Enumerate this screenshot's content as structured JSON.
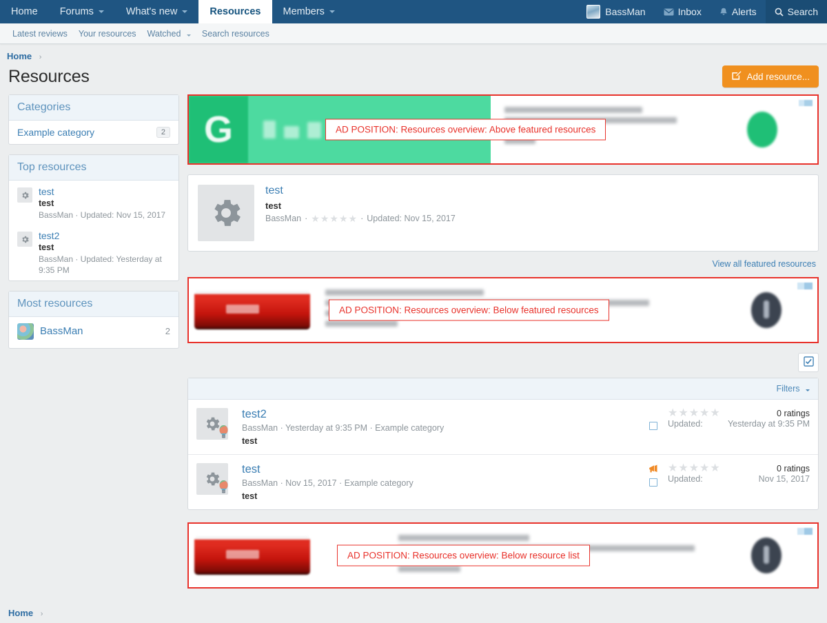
{
  "nav": {
    "items": [
      {
        "label": "Home",
        "has_caret": false,
        "active": false
      },
      {
        "label": "Forums",
        "has_caret": true,
        "active": false
      },
      {
        "label": "What's new",
        "has_caret": true,
        "active": false
      },
      {
        "label": "Resources",
        "has_caret": false,
        "active": true
      },
      {
        "label": "Members",
        "has_caret": true,
        "active": false
      }
    ],
    "right": {
      "username": "BassMan",
      "inbox": "Inbox",
      "alerts": "Alerts",
      "search": "Search"
    }
  },
  "subnav": {
    "items": [
      {
        "label": "Latest reviews",
        "has_caret": false
      },
      {
        "label": "Your resources",
        "has_caret": false
      },
      {
        "label": "Watched",
        "has_caret": true
      },
      {
        "label": "Search resources",
        "has_caret": false
      }
    ]
  },
  "breadcrumb": {
    "home": "Home"
  },
  "page": {
    "title": "Resources",
    "add_button": "Add resource..."
  },
  "sidebar": {
    "categories": {
      "header": "Categories",
      "items": [
        {
          "label": "Example category",
          "count": "2"
        }
      ]
    },
    "top_resources": {
      "header": "Top resources",
      "items": [
        {
          "title": "test",
          "desc": "test",
          "meta": "BassMan · Updated: Nov 15, 2017"
        },
        {
          "title": "test2",
          "desc": "test",
          "meta": "BassMan · Updated: Yesterday at 9:35 PM"
        }
      ]
    },
    "most_resources": {
      "header": "Most resources",
      "items": [
        {
          "name": "BassMan",
          "count": "2"
        }
      ]
    }
  },
  "ads": [
    {
      "id": "ad-above-featured",
      "label": "AD POSITION: Resources overview: Above featured resources"
    },
    {
      "id": "ad-below-featured",
      "label": "AD POSITION: Resources overview: Below featured resources"
    },
    {
      "id": "ad-below-list",
      "label": "AD POSITION: Resources overview: Below resource list"
    }
  ],
  "featured": {
    "resource": {
      "title": "test",
      "desc": "test",
      "author": "BassMan",
      "sep1": "·",
      "sep2": "·",
      "updated": "Updated: Nov 15, 2017",
      "rating": 0,
      "stars_total": 5
    },
    "view_all": "View all featured resources"
  },
  "list": {
    "filters_label": "Filters",
    "rows": [
      {
        "title": "test2",
        "meta": "BassMan · Yesterday at 9:35 PM · Example category",
        "desc": "test",
        "ratings_text": "0 ratings",
        "updated_label": "Updated:",
        "updated_value": "Yesterday at 9:35 PM",
        "rating": 0,
        "stars_total": 5,
        "has_announce_icon": false
      },
      {
        "title": "test",
        "meta": "BassMan · Nov 15, 2017 · Example category",
        "desc": "test",
        "ratings_text": "0 ratings",
        "updated_label": "Updated:",
        "updated_value": "Nov 15, 2017",
        "rating": 0,
        "stars_total": 5,
        "has_announce_icon": true
      }
    ]
  },
  "footer": {
    "home": "Home"
  },
  "colors": {
    "nav_bg": "#1f5582",
    "page_bg": "#eceeef",
    "accent_link": "#3b7eb3",
    "add_button": "#f0901f",
    "ad_border": "#e8312a",
    "ad_text": "#e8312a",
    "green_ad": "#4ddaa0"
  }
}
